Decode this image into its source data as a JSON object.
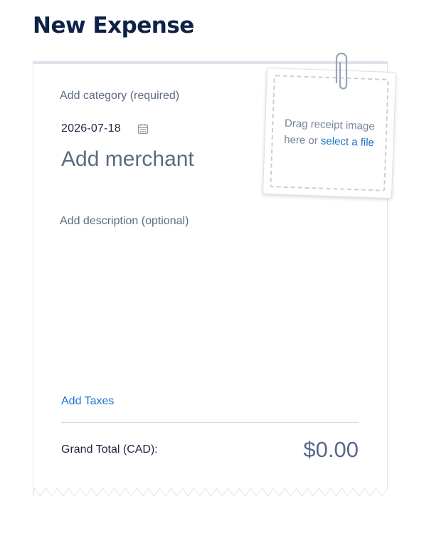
{
  "page": {
    "title": "New Expense"
  },
  "form": {
    "category_placeholder": "Add category (required)",
    "date_value": "2026-07-18",
    "merchant_placeholder": "Add merchant",
    "description_placeholder": "Add description (optional)",
    "add_taxes_label": "Add Taxes",
    "grand_total_label": "Grand Total (CAD):",
    "grand_total_value": "$0.00"
  },
  "receipt_upload": {
    "prompt_line1": "Drag receipt image",
    "prompt_line2_prefix": "here or ",
    "select_link": "select a file"
  },
  "icons": {
    "calendar": "calendar-icon",
    "paperclip": "paperclip-icon"
  },
  "colors": {
    "title": "#0e2247",
    "link": "#1a73c9",
    "muted_text": "#5d6b82",
    "total_value": "#58698a",
    "dashed_border": "#d2c9dc"
  }
}
